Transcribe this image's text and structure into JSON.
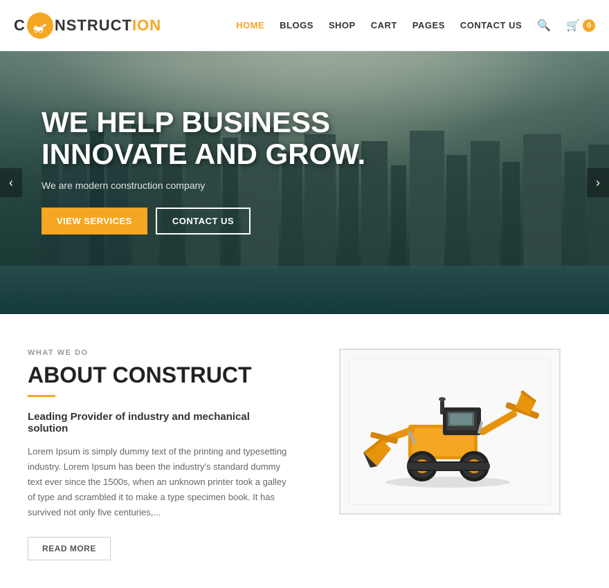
{
  "header": {
    "logo": {
      "c": "C",
      "icon_symbol": "🏗",
      "onstruction": "NSTRUCT",
      "ion": "ION"
    },
    "nav": {
      "items": [
        {
          "label": "HOME",
          "active": true
        },
        {
          "label": "BLOGS",
          "active": false
        },
        {
          "label": "SHOP",
          "active": false
        },
        {
          "label": "CART",
          "active": false
        },
        {
          "label": "PAGES",
          "active": false
        },
        {
          "label": "CONTACT US",
          "active": false
        }
      ],
      "cart_count": "0"
    }
  },
  "hero": {
    "title_line1": "WE HELP BUSINESS",
    "title_line2": "INNOVATE AND GROW.",
    "subtitle": "We are modern construction company",
    "btn_services": "VIEW SERVICES",
    "btn_contact": "CONTACT US"
  },
  "about": {
    "what_label": "WHAT WE DO",
    "title": "ABOUT CONSTRUCT",
    "lead": "Leading Provider of industry and mechanical solution",
    "body": "Lorem Ipsum is simply dummy text of the printing and typesetting industry. Lorem Ipsum has been the industry's standard dummy text ever since the 1500s, when an unknown printer took a galley of type and scrambled it to make a type specimen book. It has survived not only five centuries,...",
    "read_more": "Read More"
  },
  "colors": {
    "accent": "#f5a623",
    "dark": "#222222",
    "light_gray": "#999999"
  }
}
